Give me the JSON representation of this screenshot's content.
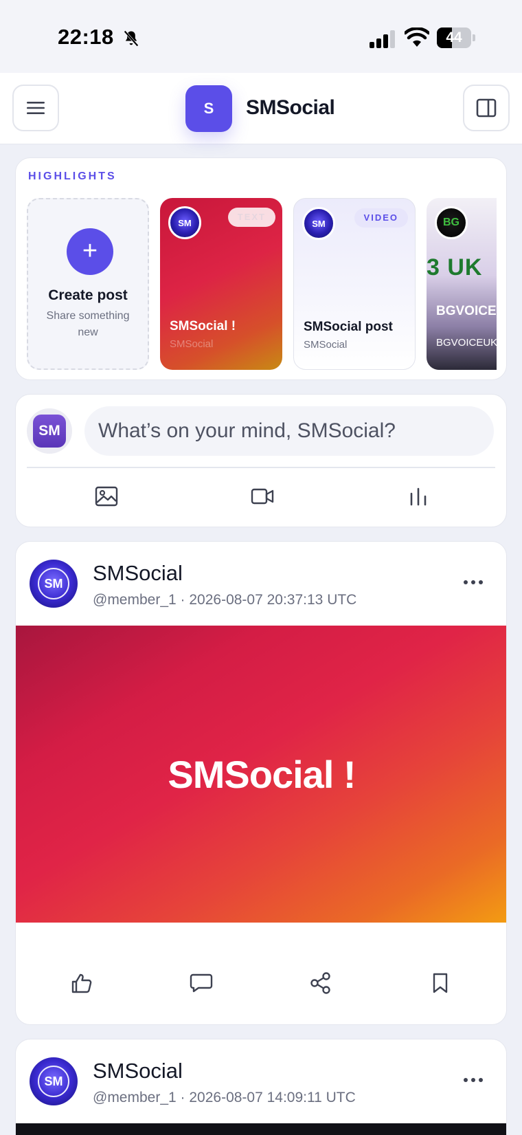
{
  "status_bar": {
    "time": "22:18",
    "battery": "44",
    "battery_level": 0.44,
    "icons": [
      "bell-muted-icon",
      "cellular-signal-icon",
      "wifi-icon",
      "battery-icon"
    ]
  },
  "header": {
    "logo_letter": "S",
    "brand_name": "SMSocial",
    "menu_icon": "hamburger-menu-icon",
    "panel_icon": "sidebar-panel-icon",
    "accent_color": "#5b4ee8"
  },
  "highlights": {
    "title": "HIGHLIGHTS",
    "create": {
      "label": "Create post",
      "sublabel": "Share something new",
      "icon": "plus-icon"
    },
    "tiles": [
      {
        "avatar": "SM",
        "badge": "TEXT",
        "title": "SMSocial !",
        "subtitle": "SMSocial"
      },
      {
        "avatar": "SM",
        "badge": "VIDEO",
        "title": "SMSocial post",
        "subtitle": "SMSocial"
      },
      {
        "avatar": "BG",
        "image_text": "3 UK",
        "title": "BGVOICE post",
        "subtitle": "BGVOICEUK"
      }
    ]
  },
  "composer": {
    "avatar": "SM",
    "placeholder": "What’s on your mind, SMSocial?",
    "actions": [
      "image-icon",
      "video-camera-icon",
      "poll-chart-icon"
    ]
  },
  "posts": [
    {
      "avatar": "SM",
      "name": "SMSocial",
      "meta": "@member_1 · 2026-08-07 20:37:13 UTC",
      "media_text": "SMSocial !",
      "actions": [
        "like-thumb-icon",
        "comment-icon",
        "share-icon",
        "bookmark-icon"
      ]
    },
    {
      "avatar": "SM",
      "name": "SMSocial",
      "meta": "@member_1 · 2026-08-07 14:09:11 UTC"
    }
  ]
}
